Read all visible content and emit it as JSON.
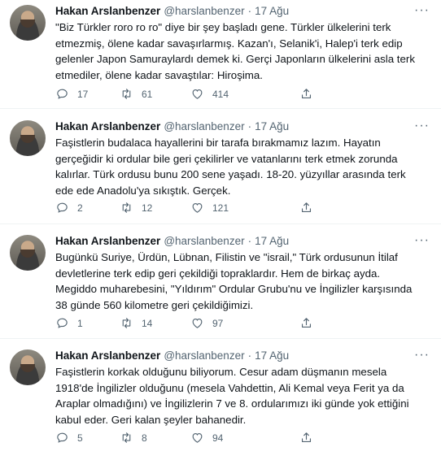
{
  "tweets": [
    {
      "name": "Hakan Arslanbenzer",
      "handle": "@harslanbenzer",
      "date": "17 Ağu",
      "lines": [
        "\"Biz Türkler roro ro ro\" diye bir şey başladı gene. Türkler ülkelerini terk",
        "etmezmiş, ölene kadar savaşırlarmış. Kazan'ı, Selanik'i, Halep'i terk edip",
        "gelenler Japon Samuraylardı demek ki. Gerçi Japonların ülkelerini asla terk",
        "etmediler, ölene kadar savaştılar: Hiroşima."
      ],
      "replies": "17",
      "retweets": "61",
      "likes": "414"
    },
    {
      "name": "Hakan Arslanbenzer",
      "handle": "@harslanbenzer",
      "date": "17 Ağu",
      "lines": [
        "Faşistlerin budalaca hayallerini bir tarafa bırakmamız lazım. Hayatın",
        "gerçeğidir ki ordular bile geri çekilirler ve vatanlarını terk etmek zorunda",
        "kalırlar. Türk ordusu bunu 200 sene yaşadı. 18-20. yüzyıllar arasında terk",
        "ede ede Anadolu'ya sıkıştık. Gerçek."
      ],
      "replies": "2",
      "retweets": "12",
      "likes": "121"
    },
    {
      "name": "Hakan Arslanbenzer",
      "handle": "@harslanbenzer",
      "date": "17 Ağu",
      "lines": [
        "Bugünkü Suriye, Ürdün, Lübnan, Filistin ve \"israil,\" Türk ordusunun İtilaf",
        "devletlerine terk edip geri çekildiği topraklardır. Hem de birkaç ayda.",
        "Megiddo muharebesini, \"Yıldırım\" Ordular Grubu'nu ve İngilizler karşısında",
        "38 günde 560 kilometre geri çekildiğimizi."
      ],
      "replies": "1",
      "retweets": "14",
      "likes": "97"
    },
    {
      "name": "Hakan Arslanbenzer",
      "handle": "@harslanbenzer",
      "date": "17 Ağu",
      "lines": [
        "Faşistlerin korkak olduğunu biliyorum. Cesur adam düşmanın mesela",
        "1918'de İngilizler olduğunu (mesela Vahdettin, Ali Kemal veya Ferit ya da",
        "Araplar olmadığını) ve İngilizlerin 7 ve 8. ordularımızı iki günde yok ettiğini",
        "kabul eder. Geri kalan şeyler bahanedir."
      ],
      "replies": "5",
      "retweets": "8",
      "likes": "94"
    }
  ],
  "icons": {
    "reply": "reply-icon",
    "retweet": "retweet-icon",
    "like": "heart-icon",
    "share": "share-icon",
    "more": "more-icon"
  },
  "colors": {
    "text": "#0f1419",
    "secondary": "#536471",
    "divider": "#eff3f4"
  }
}
